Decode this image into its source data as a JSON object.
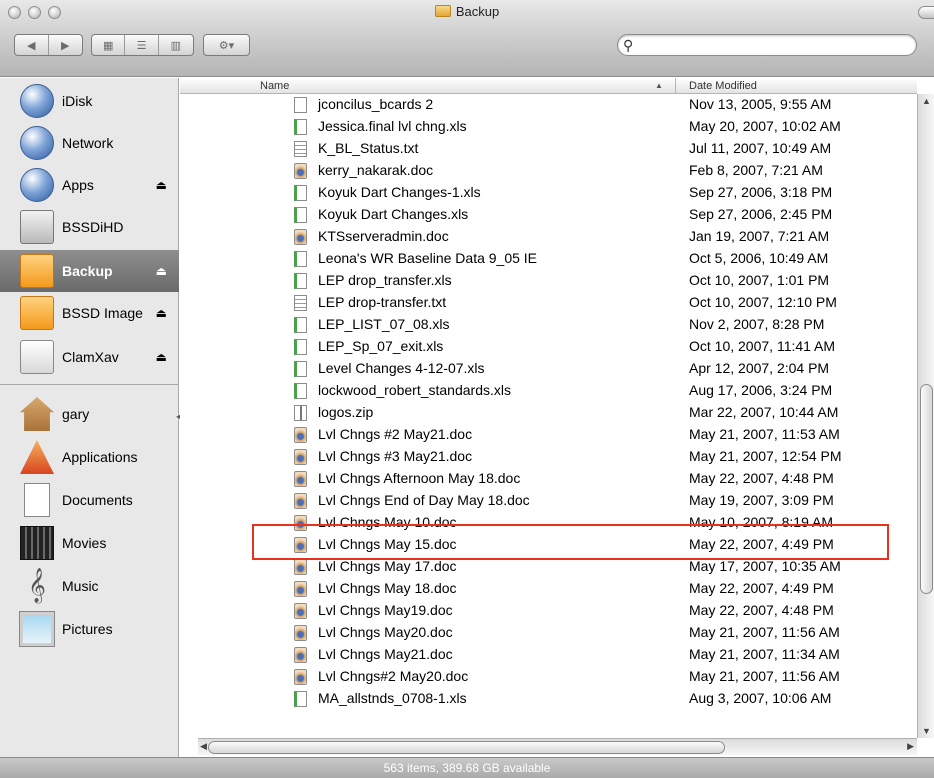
{
  "window": {
    "title": "Backup"
  },
  "toolbar": {
    "search_placeholder": ""
  },
  "sidebar": {
    "devices": [
      {
        "label": "iDisk",
        "icon": "idisk-globe-icon",
        "eject": false,
        "selected": false
      },
      {
        "label": "Network",
        "icon": "network-globe-icon",
        "eject": false,
        "selected": false
      },
      {
        "label": "Apps",
        "icon": "apps-globe-icon",
        "eject": true,
        "selected": false
      },
      {
        "label": "BSSDiHD",
        "icon": "hard-drive-icon",
        "eject": false,
        "selected": false
      },
      {
        "label": "Backup",
        "icon": "backup-disk-icon",
        "eject": true,
        "selected": true
      },
      {
        "label": "BSSD Image",
        "icon": "disk-image-icon",
        "eject": true,
        "selected": false
      },
      {
        "label": "ClamXav",
        "icon": "clamxav-disk-icon",
        "eject": true,
        "selected": false
      }
    ],
    "places": [
      {
        "label": "gary",
        "icon": "home-icon"
      },
      {
        "label": "Applications",
        "icon": "applications-icon"
      },
      {
        "label": "Documents",
        "icon": "documents-icon"
      },
      {
        "label": "Movies",
        "icon": "movies-icon"
      },
      {
        "label": "Music",
        "icon": "music-icon"
      },
      {
        "label": "Pictures",
        "icon": "pictures-icon"
      }
    ]
  },
  "list": {
    "columns": {
      "name": "Name",
      "date": "Date Modified"
    },
    "files": [
      {
        "name": "jconcilus_bcards 2",
        "date": "Nov 13, 2005, 9:55 AM",
        "type": "generic"
      },
      {
        "name": "Jessica.final lvl chng.xls",
        "date": "May 20, 2007, 10:02 AM",
        "type": "xls"
      },
      {
        "name": "K_BL_Status.txt",
        "date": "Jul 11, 2007, 10:49 AM",
        "type": "txt"
      },
      {
        "name": "kerry_nakarak.doc",
        "date": "Feb 8, 2007, 7:21 AM",
        "type": "doc"
      },
      {
        "name": "Koyuk Dart Changes-1.xls",
        "date": "Sep 27, 2006, 3:18 PM",
        "type": "xls"
      },
      {
        "name": "Koyuk Dart Changes.xls",
        "date": "Sep 27, 2006, 2:45 PM",
        "type": "xls"
      },
      {
        "name": "KTSserveradmin.doc",
        "date": "Jan 19, 2007, 7:21 AM",
        "type": "doc"
      },
      {
        "name": "Leona's WR Baseline Data 9_05 IE",
        "date": "Oct 5, 2006, 10:49 AM",
        "type": "xls"
      },
      {
        "name": "LEP drop_transfer.xls",
        "date": "Oct 10, 2007, 1:01 PM",
        "type": "xls"
      },
      {
        "name": "LEP drop-transfer.txt",
        "date": "Oct 10, 2007, 12:10 PM",
        "type": "txt"
      },
      {
        "name": "LEP_LIST_07_08.xls",
        "date": "Nov 2, 2007, 8:28 PM",
        "type": "xls"
      },
      {
        "name": "LEP_Sp_07_exit.xls",
        "date": "Oct 10, 2007, 11:41 AM",
        "type": "xls"
      },
      {
        "name": "Level Changes 4-12-07.xls",
        "date": "Apr 12, 2007, 2:04 PM",
        "type": "xls"
      },
      {
        "name": "lockwood_robert_standards.xls",
        "date": "Aug 17, 2006, 3:24 PM",
        "type": "xls"
      },
      {
        "name": "logos.zip",
        "date": "Mar 22, 2007, 10:44 AM",
        "type": "zip"
      },
      {
        "name": "Lvl Chngs #2 May21.doc",
        "date": "May 21, 2007, 11:53 AM",
        "type": "doc"
      },
      {
        "name": "Lvl Chngs #3 May21.doc",
        "date": "May 21, 2007, 12:54 PM",
        "type": "doc"
      },
      {
        "name": "Lvl Chngs Afternoon May 18.doc",
        "date": "May 22, 2007, 4:48 PM",
        "type": "doc"
      },
      {
        "name": "Lvl Chngs End of Day May 18.doc",
        "date": "May 19, 2007, 3:09 PM",
        "type": "doc"
      },
      {
        "name": "Lvl Chngs May 10.doc",
        "date": "May 10, 2007, 8:19 AM",
        "type": "doc"
      },
      {
        "name": "Lvl Chngs May 15.doc",
        "date": "May 22, 2007, 4:49 PM",
        "type": "doc"
      },
      {
        "name": "Lvl Chngs May 17.doc",
        "date": "May 17, 2007, 10:35 AM",
        "type": "doc"
      },
      {
        "name": "Lvl Chngs May 18.doc",
        "date": "May 22, 2007, 4:49 PM",
        "type": "doc"
      },
      {
        "name": "Lvl Chngs May19.doc",
        "date": "May 22, 2007, 4:48 PM",
        "type": "doc"
      },
      {
        "name": "Lvl Chngs May20.doc",
        "date": "May 21, 2007, 11:56 AM",
        "type": "doc"
      },
      {
        "name": "Lvl Chngs May21.doc",
        "date": "May 21, 2007, 11:34 AM",
        "type": "doc"
      },
      {
        "name": "Lvl Chngs#2 May20.doc",
        "date": "May 21, 2007, 11:56 AM",
        "type": "doc"
      },
      {
        "name": "MA_allstnds_0708-1.xls",
        "date": "Aug 3, 2007, 10:06 AM",
        "type": "xls"
      }
    ],
    "highlighted_file": "Lvl Chngs May 10.doc"
  },
  "status": {
    "text": "563 items, 389.68 GB available"
  },
  "colors": {
    "highlight_outline": "#e8321e",
    "selected_sidebar": "#7a7a7a"
  }
}
